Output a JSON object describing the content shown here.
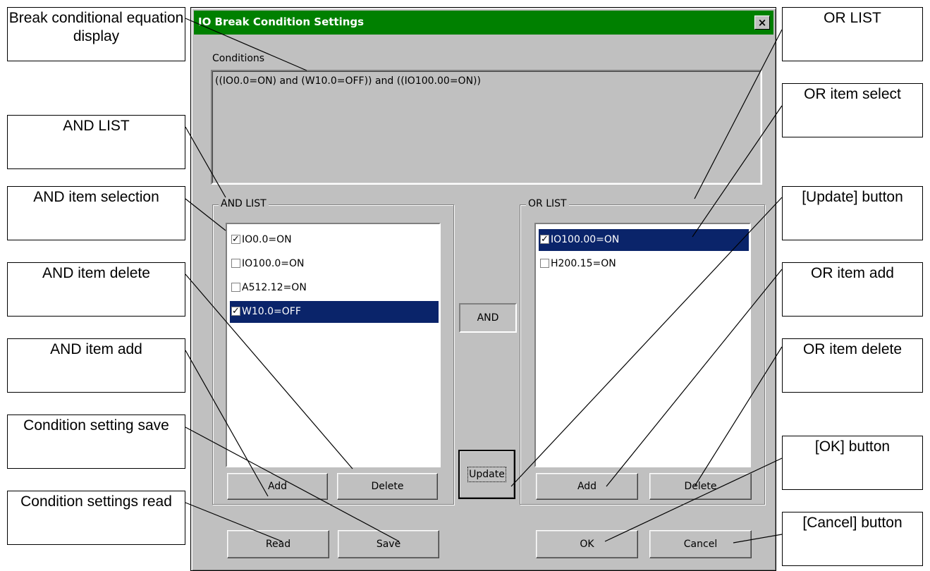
{
  "dialog": {
    "title": "IO Break Condition Settings",
    "close_label": "×",
    "conditions_label": "Conditions",
    "conditions_text": "((IO0.0=ON) and (W10.0=OFF)) and ((IO100.00=ON))",
    "and_list": {
      "title": "AND LIST",
      "items": [
        {
          "label": "IO0.0=ON",
          "checked": true,
          "selected": false
        },
        {
          "label": "IO100.0=ON",
          "checked": false,
          "selected": false
        },
        {
          "label": "A512.12=ON",
          "checked": false,
          "selected": false
        },
        {
          "label": "W10.0=OFF",
          "checked": true,
          "selected": true
        }
      ],
      "add_label": "Add",
      "delete_label": "Delete"
    },
    "operator_label": "AND",
    "update_label": "Update",
    "or_list": {
      "title": "OR LIST",
      "items": [
        {
          "label": "IO100.00=ON",
          "checked": true,
          "selected": true
        },
        {
          "label": "H200.15=ON",
          "checked": false,
          "selected": false
        }
      ],
      "add_label": "Add",
      "delete_label": "Delete"
    },
    "read_label": "Read",
    "save_label": "Save",
    "ok_label": "OK",
    "cancel_label": "Cancel"
  },
  "callouts": {
    "break_conditional": "Break conditional equation display",
    "and_list": "AND LIST",
    "and_item_selection": "AND item selection",
    "and_item_delete": "AND item delete",
    "and_item_add": "AND item add",
    "condition_setting_save": "Condition setting save",
    "condition_settings_read": "Condition settings read",
    "or_list": "OR LIST",
    "or_item_select": "OR item select",
    "update_button": "[Update] button",
    "or_item_add": "OR item add",
    "or_item_delete": "OR item delete",
    "ok_button": "[OK] button",
    "cancel_button": "[Cancel] button"
  }
}
